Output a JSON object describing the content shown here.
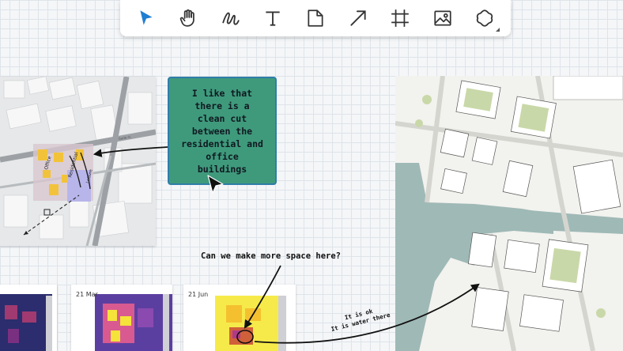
{
  "toolbar": {
    "tools": [
      {
        "id": "select",
        "icon": "pointer-icon"
      },
      {
        "id": "pan",
        "icon": "hand-icon"
      },
      {
        "id": "draw",
        "icon": "pen-squiggle-icon"
      },
      {
        "id": "text",
        "icon": "text-icon"
      },
      {
        "id": "note",
        "icon": "sticky-note-icon"
      },
      {
        "id": "arrow",
        "icon": "arrow-icon"
      },
      {
        "id": "frame",
        "icon": "frame-icon"
      },
      {
        "id": "image",
        "icon": "image-icon"
      },
      {
        "id": "shape",
        "icon": "shape-icon"
      }
    ],
    "active_tool": "select",
    "accent_color": "#1f7fd1"
  },
  "sticky_note": {
    "text": "I like that there is a clean cut between the residential and office buildings",
    "background_color": "#3f9a7c",
    "border_color": "#2f7ea8"
  },
  "comments": {
    "space": "Can we make more space here?",
    "water_line1": "It is ok",
    "water_line2": "It is water there"
  },
  "thumbnails": [
    {
      "label": ""
    },
    {
      "label": "21 Mar"
    },
    {
      "label": "21 Jun"
    }
  ]
}
